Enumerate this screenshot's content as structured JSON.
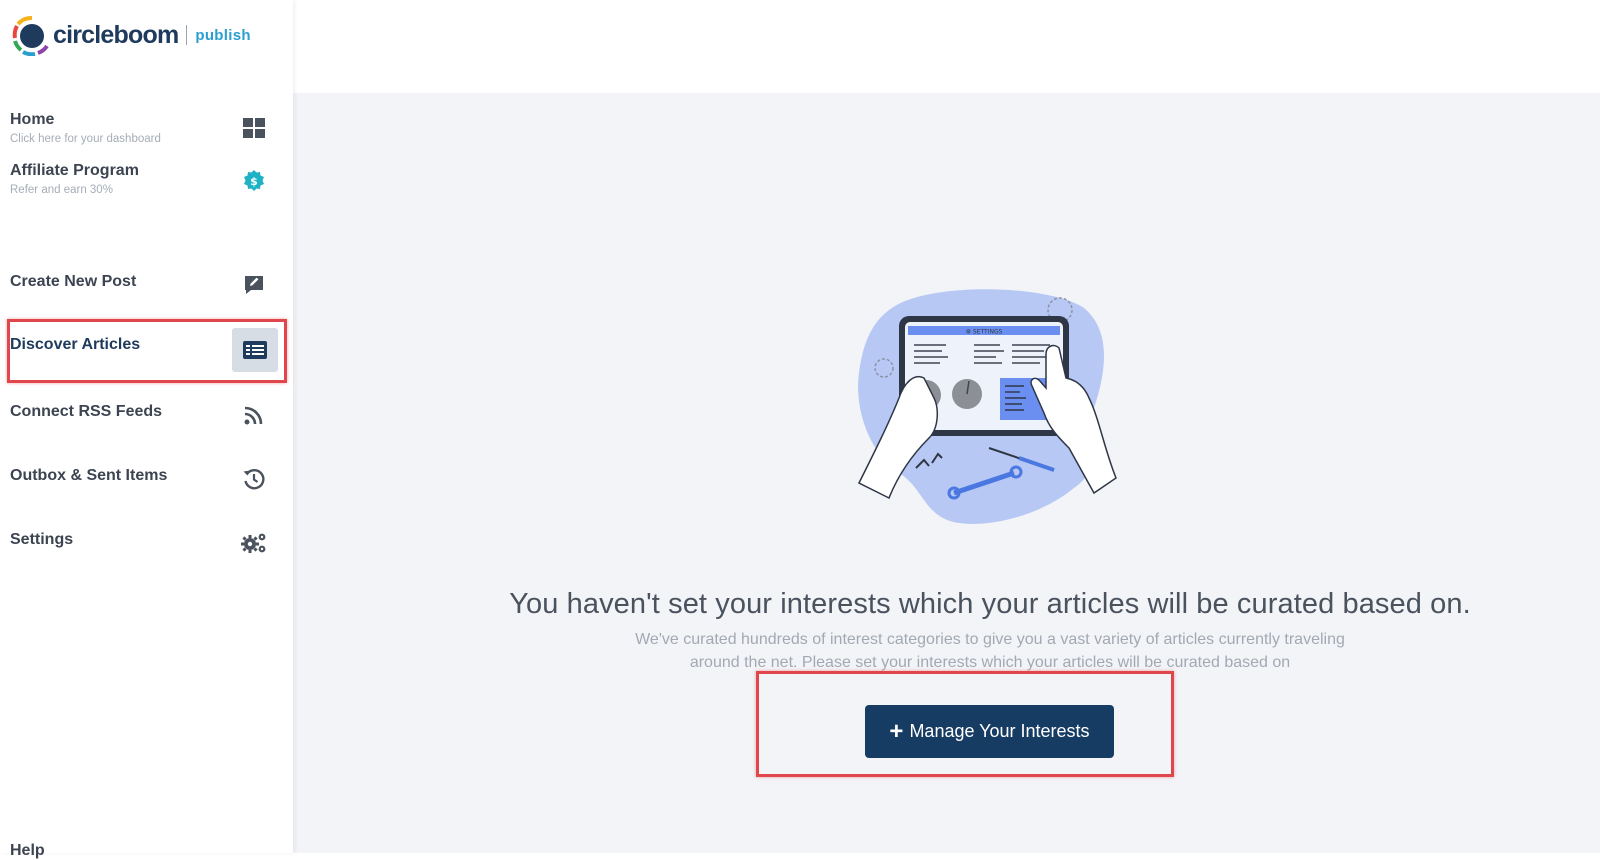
{
  "brand": {
    "name": "circleboom",
    "product": "publish",
    "colors": {
      "navy": "#1e3a5c",
      "accent": "#2a9fd0",
      "button": "#173c64",
      "highlight": "#e0474c"
    }
  },
  "sidebar": {
    "items": [
      {
        "label": "Home",
        "sublabel": "Click here for your dashboard",
        "icon": "dashboard-grid-icon"
      },
      {
        "label": "Affiliate Program",
        "sublabel": "Refer and earn 30%",
        "icon": "dollar-badge-icon"
      },
      {
        "label": "Create New Post",
        "icon": "edit-post-icon"
      },
      {
        "label": "Discover Articles",
        "icon": "articles-icon",
        "active": true
      },
      {
        "label": "Connect RSS Feeds",
        "icon": "rss-icon"
      },
      {
        "label": "Outbox & Sent Items",
        "icon": "history-icon"
      },
      {
        "label": "Settings",
        "icon": "gears-icon"
      }
    ],
    "help_label": "Help"
  },
  "main": {
    "illustration": "tablet-settings-illustration",
    "headline": "You haven't set your interests which your articles will be curated based on.",
    "description_line1": "We've curated hundreds of interest categories to give you a vast variety of articles currently traveling",
    "description_line2": "around the net. Please set your interests which your articles will be curated based on",
    "cta_label": "Manage Your Interests"
  }
}
